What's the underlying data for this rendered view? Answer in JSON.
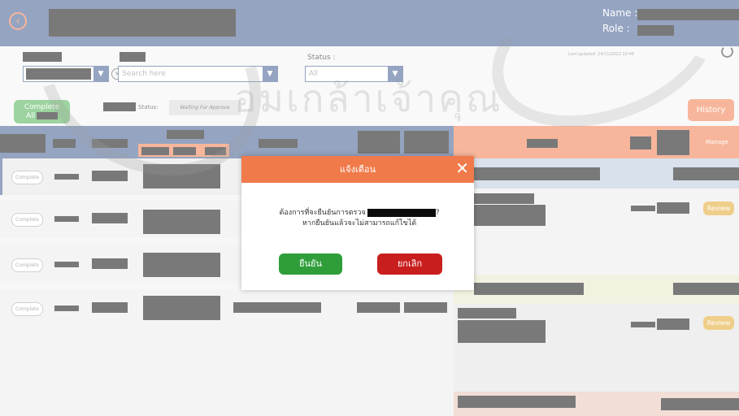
{
  "header": {
    "name_label": "Name :",
    "role_label": "Role :",
    "colors": {
      "bar": "#3c5a8f",
      "accent": "#f07a4a"
    }
  },
  "filters": {
    "search_placeholder": "Search here",
    "status_label": "Status :",
    "status_value": "All",
    "last_updated": "Last updated: 24/11/2023 10:46"
  },
  "toolbar": {
    "complete_all_line1": "Complete",
    "complete_all_line2": "All",
    "status_label": "Status:",
    "status_value": "Waiting For Approve",
    "history_label": "History"
  },
  "table": {
    "manage_header": "Manage",
    "complete_button": "Complete",
    "review_button": "Review"
  },
  "dialog": {
    "title": "แจ้งเตือน",
    "message_line1": "ต้องการที่จะยืนยันการตรวจ",
    "message_line1_end": "?",
    "message_line2": "หากยืนยันแล้วจะไม่สามารถแก้ไขได้",
    "confirm_label": "ยืนยัน",
    "cancel_label": "ยกเลิก"
  },
  "watermark": {
    "text": "มูลนิธิศูนย์พิทักษ์สิทธิ อมเกล้าเจ้าคุณ"
  }
}
